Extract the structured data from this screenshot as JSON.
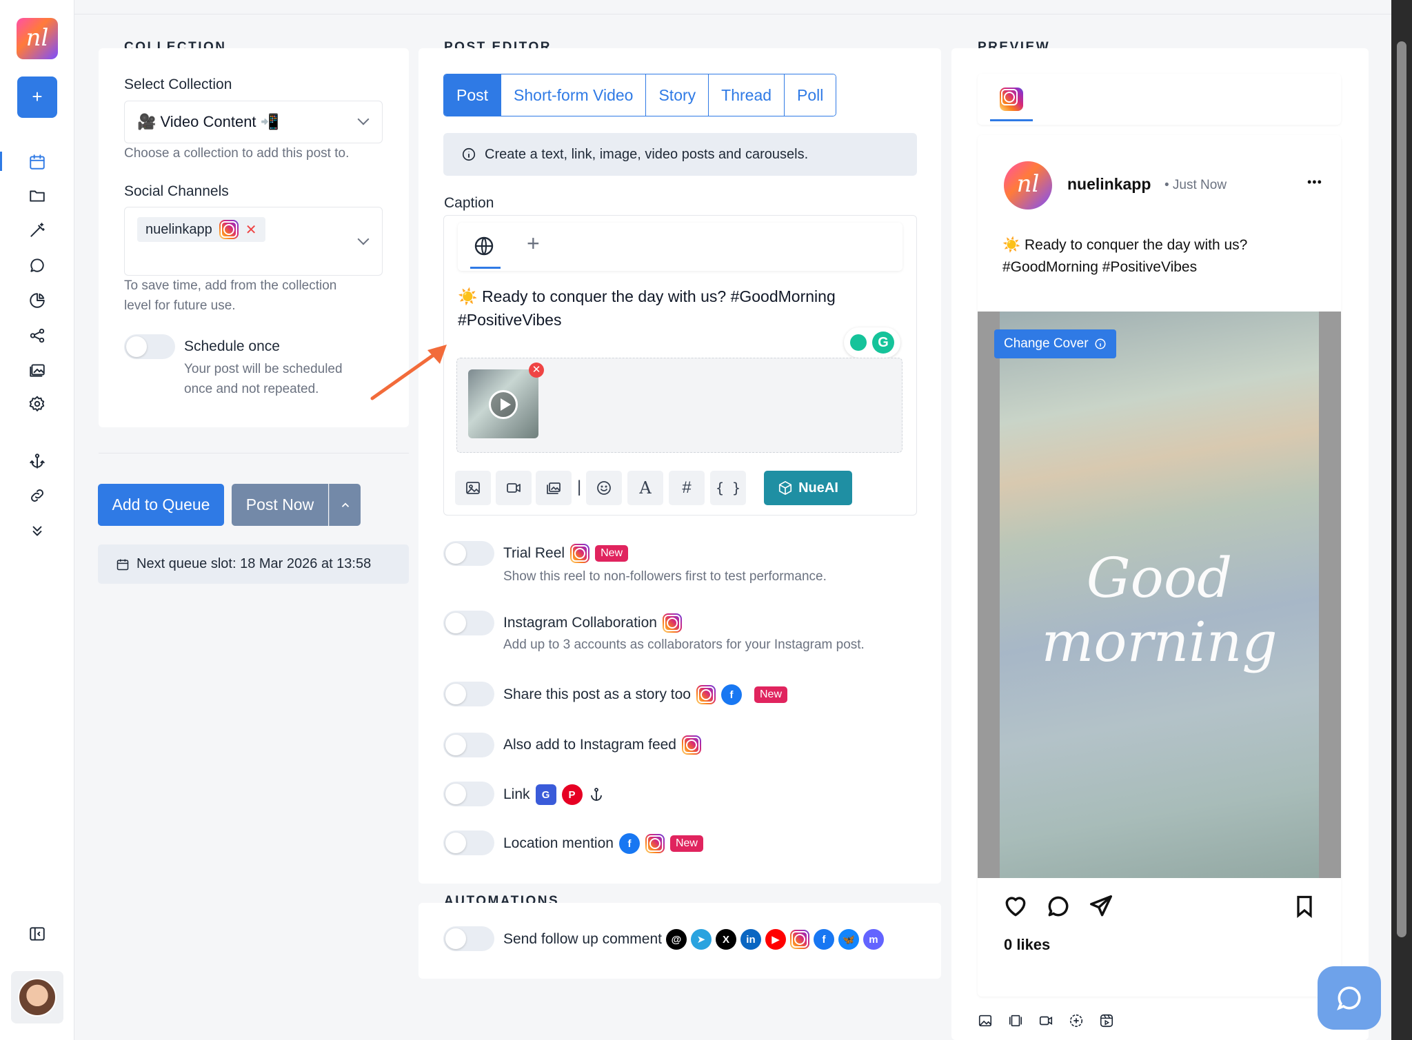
{
  "app": {
    "logo_text": "nl"
  },
  "sidebar": {
    "new_label": "+",
    "items": [
      "calendar-icon",
      "folder-icon",
      "magic-wand-icon",
      "chat-icon",
      "pie-chart-icon",
      "share-icon",
      "media-library-icon",
      "settings-icon",
      "anchor-icon",
      "link-icon",
      "expand-more-icon"
    ],
    "collapse_icon": "sidebar-toggle-icon"
  },
  "collection": {
    "section_title": "COLLECTION",
    "select_label": "Select Collection",
    "selected": "🎥 Video Content 📲",
    "select_hint": "Choose a collection to add this post to.",
    "channels_label": "Social Channels",
    "channel_chip": "nuelinkapp",
    "channels_hint_1": "To save time, add from the collection",
    "channels_hint_2": "level for future use.",
    "schedule_once_label": "Schedule once",
    "schedule_once_hint_1": "Your post will be scheduled",
    "schedule_once_hint_2": "once and not repeated."
  },
  "actions": {
    "add_to_queue": "Add to Queue",
    "post_now": "Post Now",
    "next_slot": "Next queue slot: 18 Mar 2026 at 13:58"
  },
  "editor": {
    "section_title": "POST EDITOR",
    "tabs": [
      "Post",
      "Short-form Video",
      "Story",
      "Thread",
      "Poll"
    ],
    "info": "Create a text, link, image, video posts and carousels.",
    "caption_label": "Caption",
    "caption_line1": "☀️ Ready to conquer the day with us?  #GoodMorning",
    "caption_line2": "#PositiveVibes",
    "add_lang": "+",
    "nueai": "NueAI",
    "tool_separator": "|",
    "tool_hashtag": "#",
    "tool_variables": "{ }",
    "tool_font": "A"
  },
  "options": {
    "trial_reel": "Trial Reel",
    "trial_reel_desc": "Show this reel to non-followers first to test performance.",
    "collab": "Instagram Collaboration",
    "collab_desc": "Add up to 3 accounts as collaborators for your Instagram post.",
    "share_story": "Share this post as a story too",
    "also_feed": "Also add to Instagram feed",
    "link": "Link",
    "location": "Location mention",
    "new_badge": "New"
  },
  "automations": {
    "section_title": "AUTOMATIONS",
    "follow_up": "Send follow up comment"
  },
  "preview": {
    "section_title": "PREVIEW",
    "account": "nuelinkapp",
    "time": "• Just Now",
    "caption_line1": "☀️ Ready to conquer the day with us?",
    "caption_line2": "#GoodMorning #PositiveVibes",
    "change_cover": "Change Cover",
    "image_text": "Good morning",
    "likes": "0 likes",
    "more": "•••"
  },
  "colors": {
    "accent": "#2f7ae5",
    "danger": "#e0245e",
    "nueai": "#1f8fa3"
  }
}
